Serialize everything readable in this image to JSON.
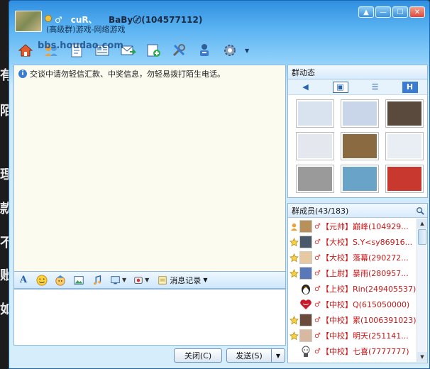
{
  "window": {
    "contact_name": "BaBy〄(104577112)",
    "nick_deco": "♂　cuR、",
    "subtitle": "(高级群)游戏-网络游戏",
    "watermark": "bbs.houdao.com",
    "controls": [
      "▲",
      "—",
      "☐",
      "✕"
    ]
  },
  "toolbar": {
    "icons": [
      "home-icon",
      "users-transfer-icon",
      "document-icon",
      "news-icon",
      "send-mail-icon",
      "add-member-icon",
      "tools-icon",
      "announce-icon",
      "settings-icon"
    ]
  },
  "chat": {
    "notice": "交谈中请勿轻信汇款、中奖信息，勿轻易拨打陌生电话。"
  },
  "format_bar": {
    "history_label": "消息记录"
  },
  "actions": {
    "close_label": "关闭(C)",
    "send_label": "发送(S)"
  },
  "group_dynamics": {
    "title": "群动态",
    "view_tabs": [
      "◀",
      "▣",
      "☰",
      "H"
    ],
    "thumb_colors": [
      "#d9e3ef",
      "#c9d5e8",
      "#5a4a3e",
      "#e4e8ee",
      "#8a6a40",
      "#e9eef4",
      "#9a9a9a",
      "#6aa3c8",
      "#c8382e"
    ]
  },
  "members": {
    "title": "群成员(43/183)",
    "list": [
      {
        "role": "owner",
        "face": "#b8905a",
        "text": "【元帅】巅峰(104929..."
      },
      {
        "role": "admin",
        "face": "#4a5a6a",
        "text": "【大校】S.Y<sy86916..."
      },
      {
        "role": "admin",
        "face": "#e8c8a0",
        "text": "【大校】落幕(290272..."
      },
      {
        "role": "admin",
        "face": "#5a78b8",
        "text": "【上尉】暴雨(280957..."
      },
      {
        "role": "",
        "face": "penguin",
        "text": "【上校】Rin(249405537)"
      },
      {
        "role": "",
        "face": "heart",
        "text": "【中校】Q(615050000)"
      },
      {
        "role": "admin",
        "face": "#6a4a3a",
        "text": "【中校】累(1006391023)"
      },
      {
        "role": "admin",
        "face": "#d8b8a0",
        "text": "【中校】明天(251141..."
      },
      {
        "role": "",
        "face": "baby",
        "text": "【中校】七喜(7777777)"
      }
    ]
  },
  "background_glyphs": [
    "有",
    "陌",
    "理",
    "款",
    "不",
    "账",
    "如"
  ]
}
